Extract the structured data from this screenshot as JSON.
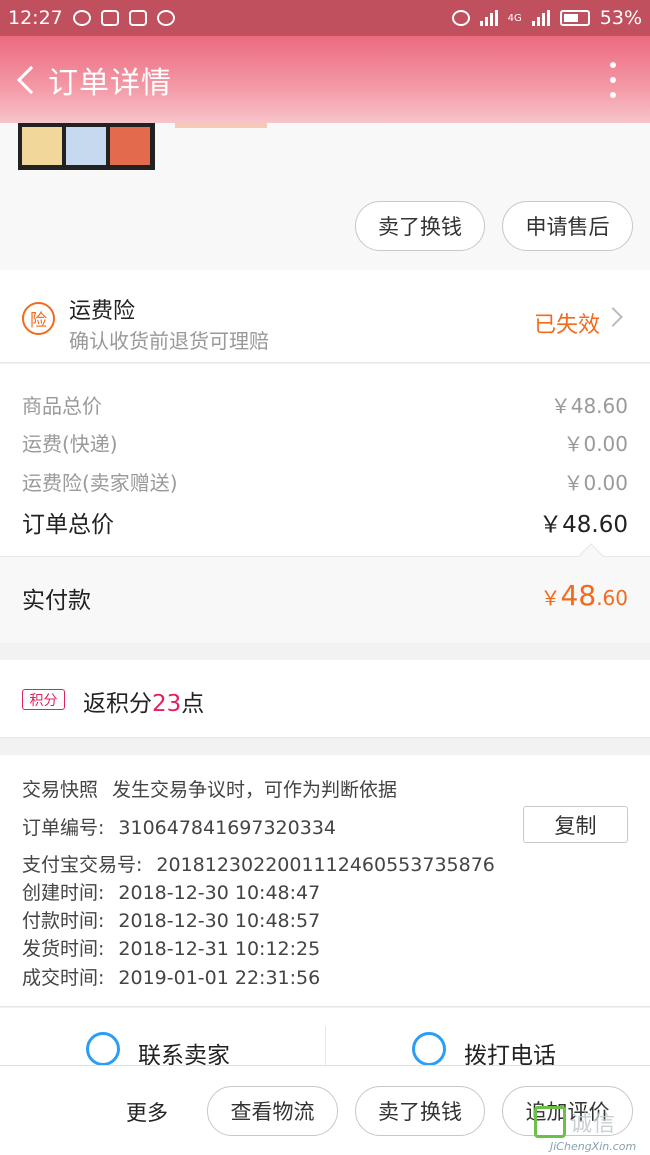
{
  "status_bar": {
    "time": "12:27",
    "network": "4G",
    "battery": "53%"
  },
  "header": {
    "title": "订单详情"
  },
  "product_actions": {
    "sell_label": "卖了换钱",
    "after_sale_label": "申请售后"
  },
  "insurance": {
    "icon_char": "险",
    "title": "运费险",
    "subtitle": "确认收货前退货可理赔",
    "status": "已失效"
  },
  "prices": {
    "items": [
      {
        "label": "商品总价",
        "value": "￥48.60"
      },
      {
        "label": "运费(快递)",
        "value": "￥0.00"
      },
      {
        "label": "运费险(卖家赠送)",
        "value": "￥0.00"
      }
    ],
    "total": {
      "label": "订单总价",
      "value": "￥48.60"
    },
    "paid": {
      "label": "实付款",
      "currency": "￥",
      "integer": "48",
      "decimal": ".60"
    }
  },
  "points": {
    "badge": "积分",
    "prefix": "返积分",
    "value": "23",
    "suffix": "点"
  },
  "order_info": {
    "snapshot_label": "交易快照",
    "snapshot_text": "发生交易争议时，可作为判断依据",
    "copy_label": "复制",
    "rows": [
      {
        "label": "订单编号:",
        "value": "310647841697320334"
      },
      {
        "label": "支付宝交易号:",
        "value": "2018123022001112460553735876"
      },
      {
        "label": "创建时间:",
        "value": "2018-12-30 10:48:47"
      },
      {
        "label": "付款时间:",
        "value": "2018-12-30 10:48:57"
      },
      {
        "label": "发货时间:",
        "value": "2018-12-31 10:12:25"
      },
      {
        "label": "成交时间:",
        "value": "2019-01-01 22:31:56"
      }
    ]
  },
  "contact": {
    "seller_label": "联系卖家",
    "phone_label": "拨打电话"
  },
  "bottom_bar": {
    "more_label": "更多",
    "logistics_label": "查看物流",
    "sell_label": "卖了换钱",
    "review_label": "追加评价"
  },
  "watermark": {
    "cn": "诚信",
    "en": "JiChengXin.com"
  },
  "colors": {
    "header": "#eb6a80",
    "accent_orange": "#f36a1c",
    "points_pink": "#e0245b",
    "link_blue": "#2b9df5"
  }
}
